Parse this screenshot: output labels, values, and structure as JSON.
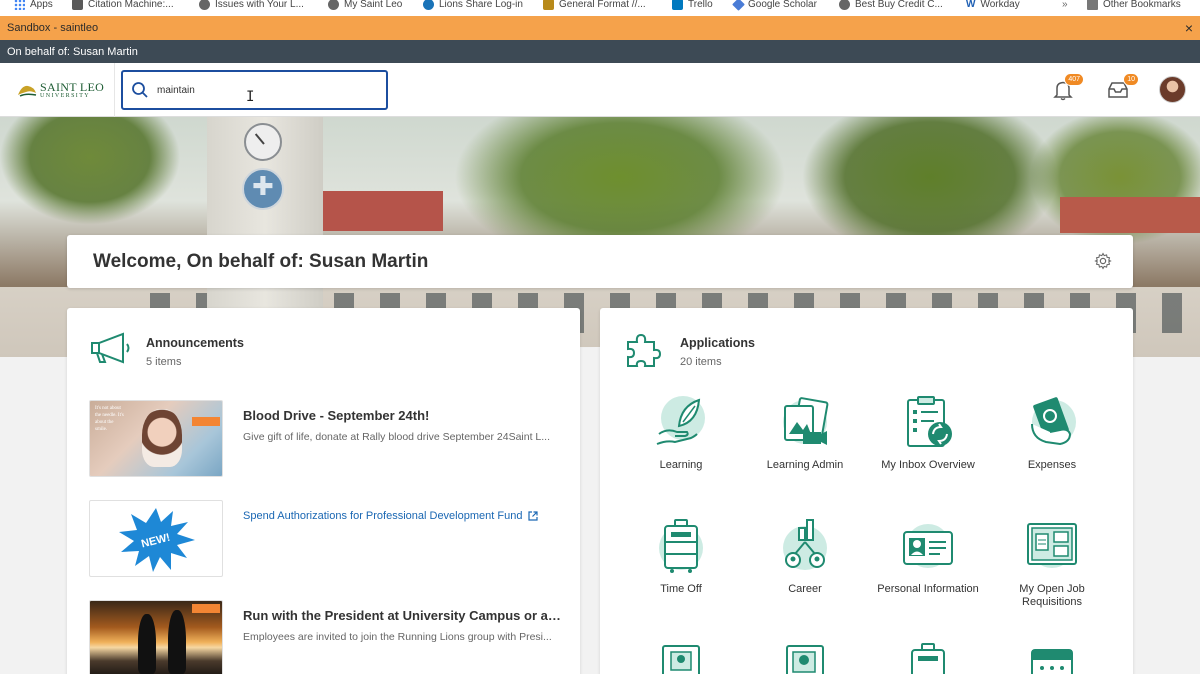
{
  "browser": {
    "bookmarks": [
      {
        "label": "Apps",
        "icon": "apps-grid-icon"
      },
      {
        "label": "Citation Machine:...",
        "icon": "citation-machine-icon"
      },
      {
        "label": "Issues with Your L...",
        "icon": "globe-icon"
      },
      {
        "label": "My Saint Leo",
        "icon": "globe-icon"
      },
      {
        "label": "Lions Share Log-in",
        "icon": "lions-share-icon"
      },
      {
        "label": "General Format //...",
        "icon": "purdue-owl-icon"
      },
      {
        "label": "Trello",
        "icon": "trello-icon"
      },
      {
        "label": "Google Scholar",
        "icon": "google-scholar-icon"
      },
      {
        "label": "Best Buy Credit C...",
        "icon": "globe-icon"
      },
      {
        "label": "Workday",
        "icon": "workday-icon"
      }
    ],
    "overflow": "»",
    "other_bookmarks": "Other Bookmarks"
  },
  "sandbox_bar": {
    "label": "Sandbox - saintleo",
    "close": "×"
  },
  "behalf_bar": {
    "label": "On behalf of: Susan Martin"
  },
  "header": {
    "logo": {
      "line1": "SAINT LEO",
      "line2": "UNIVERSITY"
    },
    "search": {
      "value": "maintain"
    },
    "notifications": {
      "count": "407",
      "icon": "bell-icon"
    },
    "inbox": {
      "count": "10",
      "icon": "inbox-icon"
    }
  },
  "welcome": {
    "title": "Welcome, On behalf of: Susan Martin"
  },
  "announcements": {
    "title": "Announcements",
    "count": "5 items",
    "items": [
      {
        "title": "Blood Drive - September 24th!",
        "description": "Give gift of life, donate at Rally blood drive September 24Saint L...",
        "thumb_text": "It's not about the needle. It's about the smile."
      },
      {
        "link": "Spend Authorizations for Professional Development Fund",
        "thumb_text": "NEW!"
      },
      {
        "title": "Run with the President at University Campus or any...",
        "description": "Employees are invited to join the Running Lions group with Presi..."
      }
    ]
  },
  "applications": {
    "title": "Applications",
    "count": "20 items",
    "items": [
      {
        "label": "Learning",
        "icon": "learning-icon"
      },
      {
        "label": "Learning Admin",
        "icon": "learning-admin-icon"
      },
      {
        "label": "My Inbox Overview",
        "icon": "inbox-overview-icon"
      },
      {
        "label": "Expenses",
        "icon": "expenses-icon"
      },
      {
        "label": "Time Off",
        "icon": "time-off-icon"
      },
      {
        "label": "Career",
        "icon": "career-icon"
      },
      {
        "label": "Personal Information",
        "icon": "personal-information-icon"
      },
      {
        "label": "My Open Job Requisitions",
        "icon": "job-requisitions-icon"
      }
    ]
  },
  "colors": {
    "sandbox": "#f5a24b",
    "behalf": "#3d4a55",
    "search_border": "#1c4e9f",
    "badge": "#f08a24",
    "icon_green": "#1f8a70",
    "icon_mint": "#cdebe3",
    "link": "#1a67b3"
  }
}
